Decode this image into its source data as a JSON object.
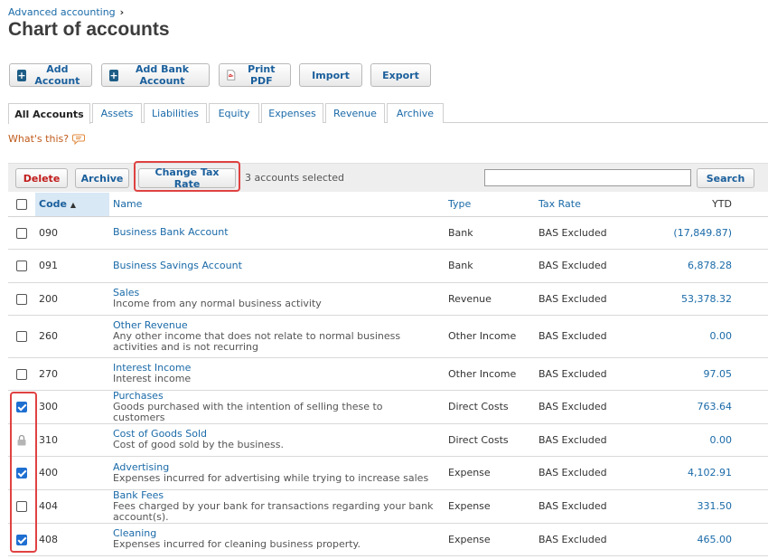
{
  "breadcrumb": {
    "parent": "Advanced accounting"
  },
  "page": {
    "title": "Chart of accounts"
  },
  "toolbar": {
    "add_account": "Add Account",
    "add_bank_account": "Add Bank Account",
    "print_pdf": "Print PDF",
    "import": "Import",
    "export": "Export"
  },
  "tabs": [
    "All Accounts",
    "Assets",
    "Liabilities",
    "Equity",
    "Expenses",
    "Revenue",
    "Archive"
  ],
  "help": {
    "whats_this": "What's this?"
  },
  "actions": {
    "delete": "Delete",
    "archive": "Archive",
    "change_tax_rate": "Change Tax Rate",
    "selected_count": "3 accounts selected",
    "search_value": "",
    "search_button": "Search"
  },
  "table": {
    "headers": {
      "code": "Code",
      "name": "Name",
      "type": "Type",
      "tax_rate": "Tax Rate",
      "ytd": "YTD"
    },
    "rows": [
      {
        "state": "unchecked",
        "code": "090",
        "name": "Business Bank Account",
        "desc": "",
        "type": "Bank",
        "tax": "BAS Excluded",
        "ytd": "(17,849.87)"
      },
      {
        "state": "unchecked",
        "code": "091",
        "name": "Business Savings Account",
        "desc": "",
        "type": "Bank",
        "tax": "BAS Excluded",
        "ytd": "6,878.28"
      },
      {
        "state": "unchecked",
        "code": "200",
        "name": "Sales",
        "desc": "Income from any normal business activity",
        "type": "Revenue",
        "tax": "BAS Excluded",
        "ytd": "53,378.32"
      },
      {
        "state": "unchecked",
        "code": "260",
        "name": "Other Revenue",
        "desc": "Any other income that does not relate to normal business activities and is not recurring",
        "type": "Other Income",
        "tax": "BAS Excluded",
        "ytd": "0.00"
      },
      {
        "state": "unchecked",
        "code": "270",
        "name": "Interest Income",
        "desc": "Interest income",
        "type": "Other Income",
        "tax": "BAS Excluded",
        "ytd": "97.05"
      },
      {
        "state": "checked",
        "code": "300",
        "name": "Purchases",
        "desc": "Goods purchased with the intention of selling these to customers",
        "type": "Direct Costs",
        "tax": "BAS Excluded",
        "ytd": "763.64"
      },
      {
        "state": "locked",
        "code": "310",
        "name": "Cost of Goods Sold",
        "desc": "Cost of good sold by the business.",
        "type": "Direct Costs",
        "tax": "BAS Excluded",
        "ytd": "0.00"
      },
      {
        "state": "checked",
        "code": "400",
        "name": "Advertising",
        "desc": "Expenses incurred for advertising while trying to increase sales",
        "type": "Expense",
        "tax": "BAS Excluded",
        "ytd": "4,102.91"
      },
      {
        "state": "unchecked",
        "code": "404",
        "name": "Bank Fees",
        "desc": "Fees charged by your bank for transactions regarding your bank account(s).",
        "type": "Expense",
        "tax": "BAS Excluded",
        "ytd": "331.50"
      },
      {
        "state": "checked",
        "code": "408",
        "name": "Cleaning",
        "desc": "Expenses incurred for cleaning business property.",
        "type": "Expense",
        "tax": "BAS Excluded",
        "ytd": "465.00"
      }
    ]
  },
  "icons": {
    "add": "plus-square-icon",
    "pdf": "pdf-file-icon",
    "help": "speech-bubble-icon",
    "lock": "lock-icon",
    "sort": "sort-ascending-icon"
  },
  "colors": {
    "link": "#1a6aa8",
    "highlight": "#e04242",
    "checkbox": "#1f6fd1",
    "delete": "#c21a1a"
  }
}
